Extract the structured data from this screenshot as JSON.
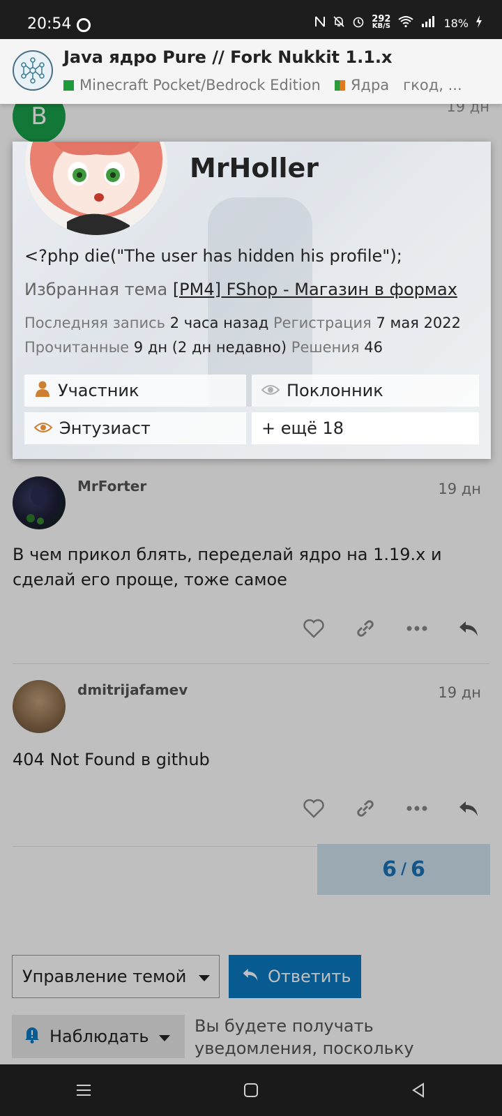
{
  "status_bar": {
    "time": "20:54",
    "speed_value": "292",
    "speed_unit": "KB/S",
    "battery": "18%"
  },
  "header": {
    "title": "Java ядро Pure // Fork Nukkit 1.1.x",
    "category_1": "Minecraft Pocket/Bedrock Edition",
    "category_1_color": "#1f9a3a",
    "category_2": "Ядра",
    "category_2_color": "#e07a1f",
    "tag": "гкод, ..."
  },
  "top_post": {
    "date": "19 дн",
    "avatar_letter": "B"
  },
  "user_card": {
    "username": "MrHoller",
    "bio": "<?php die(\"The user has hidden his profile\");",
    "featured_label": "Избранная тема",
    "featured_link": "[PM4] FShop - Магазин в формах",
    "last_post_label": "Последняя запись",
    "last_post_value": "2 часа назад",
    "joined_label": "Регистрация",
    "joined_value": "7 мая 2022",
    "read_label": "Прочитанные",
    "read_value": "9 дн (2 дн недавно)",
    "solutions_label": "Решения",
    "solutions_value": "46",
    "badges": [
      "Участник",
      "Поклонник",
      "Энтузиаст",
      "+ ещё 18"
    ]
  },
  "posts": [
    {
      "username": "MrForter",
      "date": "19 дн",
      "body": "В чем прикол блять, переделай ядро на 1.19.x и сделай его проще, тоже самое"
    },
    {
      "username": "dmitrijafamev",
      "date": "19 дн",
      "body": "404 Not Found в github"
    }
  ],
  "progress": {
    "current": "6",
    "separator": "/",
    "total": "6"
  },
  "footer": {
    "manage_label": "Управление темой",
    "reply_label": "Ответить",
    "watch_label": "Наблюдать",
    "watch_description": "Вы будете получать уведомления, поскольку"
  }
}
